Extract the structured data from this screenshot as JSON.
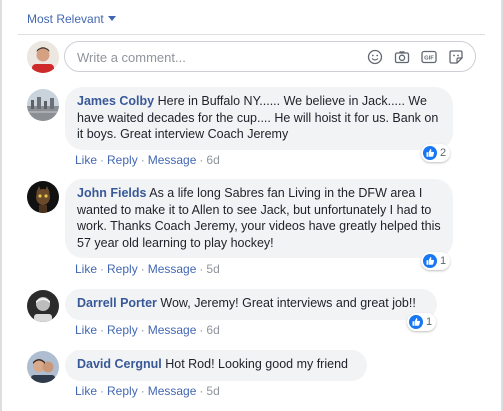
{
  "sort": {
    "label": "Most Relevant"
  },
  "composer": {
    "placeholder": "Write a comment..."
  },
  "action_labels": {
    "like": "Like",
    "reply": "Reply",
    "message": "Message"
  },
  "comments": [
    {
      "author": "James Colby",
      "text": "Here in Buffalo NY...... We believe in Jack..... We have waited decades for the cup.... He will hoist it for us. Bank on it boys. Great interview Coach Jeremy",
      "time": "6d",
      "likes": "2"
    },
    {
      "author": "John Fields",
      "text": "As a life long Sabres fan Living in the DFW area I wanted to make it to Allen to see Jack, but unfortunately I had to work. Thanks Coach Jeremy, your videos have greatly helped this 57 year old learning to play hockey!",
      "time": "5d",
      "likes": "1"
    },
    {
      "author": "Darrell Porter",
      "text": "Wow, Jeremy! Great interviews and great job!!",
      "time": "6d",
      "likes": "1"
    },
    {
      "author": "David Cergnul",
      "text": "Hot Rod! Looking good my friend",
      "time": "5d"
    }
  ],
  "colors": {
    "link": "#385898",
    "action": "#4267b2",
    "meta": "#90949c",
    "bubble": "#f2f3f5",
    "like_badge": "#1877f2"
  },
  "icons": [
    "chevron-down-icon",
    "emoji-icon",
    "camera-icon",
    "gif-icon",
    "sticker-icon",
    "thumbs-up-icon"
  ]
}
